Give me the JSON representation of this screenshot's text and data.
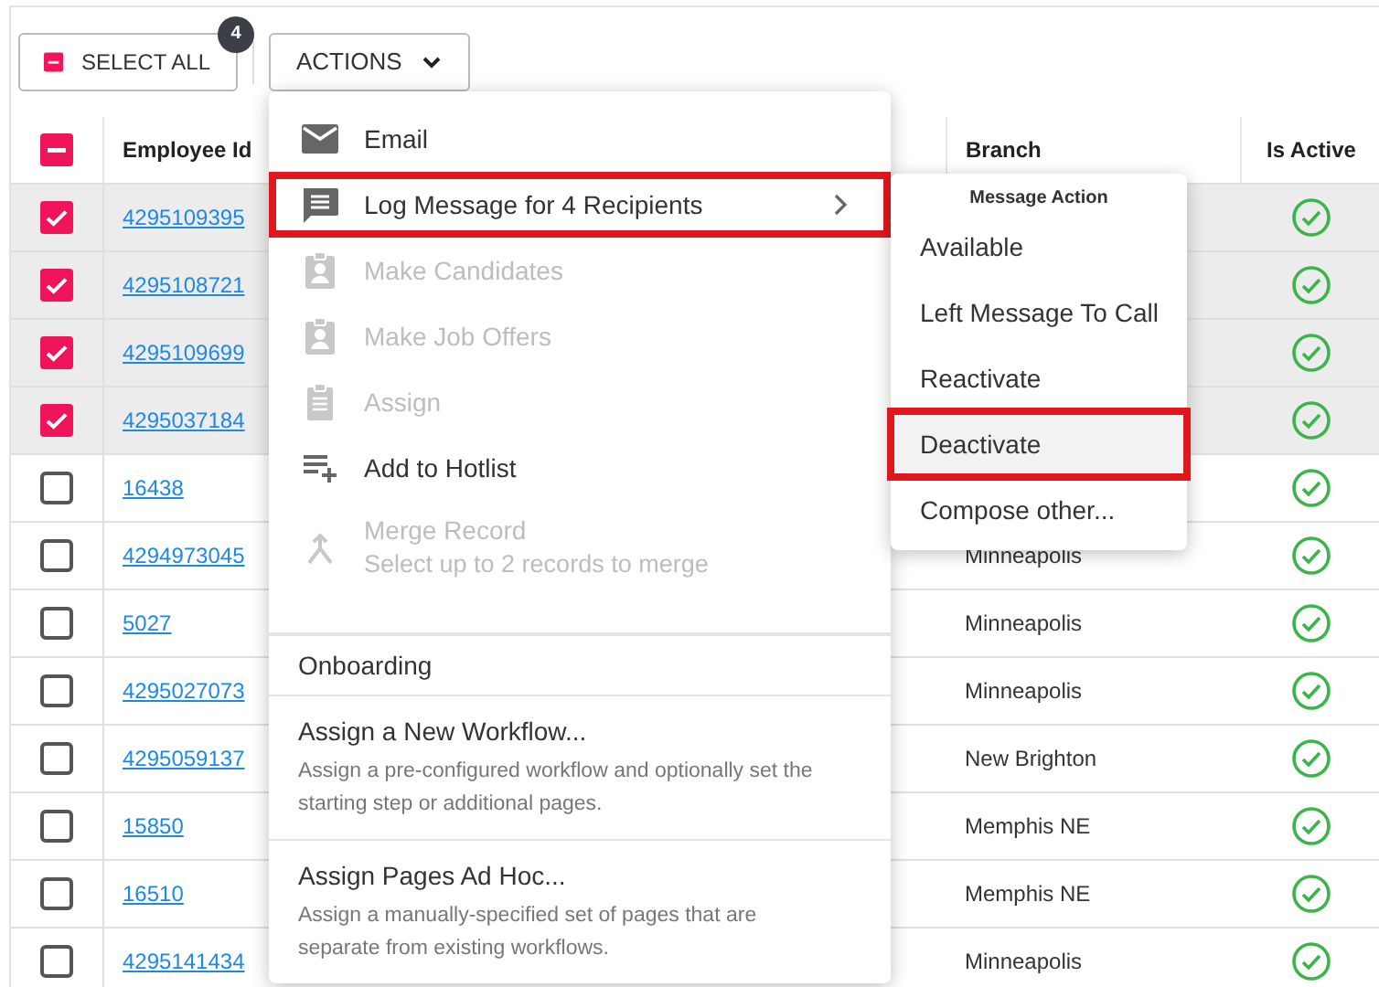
{
  "toolbar": {
    "select_all": {
      "label": "SELECT ALL",
      "count": "4",
      "indeterminate": true
    },
    "actions": {
      "label": "ACTIONS",
      "expanded": true
    }
  },
  "table": {
    "header_indeterminate": true,
    "columns": [
      "Employee Id",
      "Branch",
      "Is Active"
    ],
    "rows": [
      {
        "id": "4295109395",
        "selected": true,
        "active": true
      },
      {
        "id": "4295108721",
        "selected": true,
        "active": true
      },
      {
        "id": "4295109699",
        "selected": true,
        "active": true
      },
      {
        "id": "4295037184",
        "selected": true,
        "active": true
      },
      {
        "id": "16438",
        "selected": false,
        "active": true
      },
      {
        "id": "4294973045",
        "selected": false,
        "branch": "Minneapolis",
        "active": true
      },
      {
        "id": "5027",
        "selected": false,
        "branch": "Minneapolis",
        "active": true
      },
      {
        "id": "4295027073",
        "selected": false,
        "branch": "Minneapolis",
        "active": true
      },
      {
        "id": "4295059137",
        "selected": false,
        "branch": "New Brighton",
        "active": true
      },
      {
        "id": "15850",
        "selected": false,
        "branch": "Memphis NE",
        "active": true
      },
      {
        "id": "16510",
        "selected": false,
        "branch": "Memphis NE",
        "active": true
      },
      {
        "id": "4295141434",
        "selected": false,
        "branch": "Minneapolis",
        "active": true
      }
    ]
  },
  "menu": {
    "items": [
      {
        "kind": "email",
        "label": "Email",
        "disabled": false,
        "highlighted": false
      },
      {
        "kind": "message",
        "label": "Log Message for 4 Recipients",
        "disabled": false,
        "highlighted": true,
        "submenu": true
      },
      {
        "kind": "badge",
        "label": "Make Candidates",
        "disabled": true,
        "highlighted": false
      },
      {
        "kind": "badge",
        "label": "Make Job Offers",
        "disabled": true,
        "highlighted": false
      },
      {
        "kind": "clipboard",
        "label": "Assign",
        "disabled": true,
        "highlighted": false
      },
      {
        "kind": "playlist",
        "label": "Add to Hotlist",
        "disabled": false,
        "highlighted": false
      },
      {
        "kind": "merge",
        "label": "Merge Record",
        "note": "Select up to 2 records to merge",
        "disabled": true,
        "highlighted": false
      }
    ],
    "sections": [
      {
        "title": "Onboarding",
        "items": [
          {
            "label": "Assign a New Workflow...",
            "description": "Assign a pre-configured workflow and optionally set the starting step or additional pages."
          },
          {
            "label": "Assign Pages Ad Hoc...",
            "description": "Assign a manually-specified set of pages that are separate from existing workflows."
          }
        ]
      }
    ]
  },
  "submenu": {
    "title": "Message Action",
    "items": [
      {
        "label": "Available",
        "highlighted": false
      },
      {
        "label": "Left Message To Call",
        "highlighted": false
      },
      {
        "label": "Reactivate",
        "highlighted": false
      },
      {
        "label": "Deactivate",
        "highlighted": true
      },
      {
        "label": "Compose other...",
        "highlighted": false
      }
    ]
  }
}
